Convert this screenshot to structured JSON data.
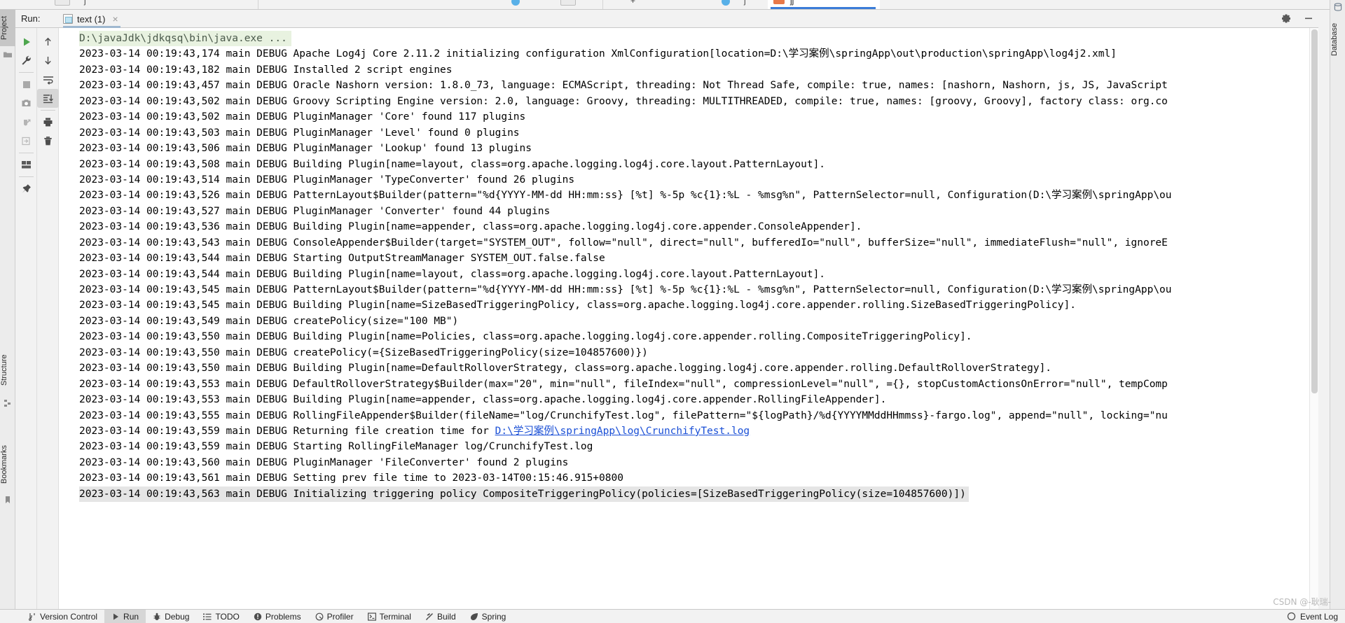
{
  "window": {
    "run_label": "Run:",
    "tab_title": "text (1)",
    "tab_close": "×",
    "settings_icon": "gear-icon",
    "minimize_icon": "minimize-icon"
  },
  "left_rail": {
    "items": [
      {
        "label": "Project",
        "icon": "project-folder-icon",
        "selected": true
      },
      {
        "label": "Structure",
        "icon": "structure-icon",
        "selected": false
      },
      {
        "label": "Bookmarks",
        "icon": "bookmarks-icon",
        "selected": false
      }
    ]
  },
  "right_rail": {
    "items": [
      {
        "label": "Database",
        "icon": "database-icon"
      }
    ]
  },
  "toolbar_primary": {
    "buttons": [
      {
        "name": "rerun-button",
        "icon": "play-green-icon",
        "label": "Rerun"
      },
      {
        "name": "edit-configuration-button",
        "icon": "wrench-icon",
        "label": "Edit Configuration"
      },
      {
        "name": "stop-button",
        "icon": "stop-square-icon",
        "label": "Stop"
      },
      {
        "name": "screenshot-button",
        "icon": "camera-icon",
        "label": "Screenshot"
      },
      {
        "name": "restart-debug-button",
        "icon": "bug-restart-icon",
        "label": "Restart Debug"
      },
      {
        "name": "resume-button",
        "icon": "arrow-into-box-icon",
        "label": "Resume Program"
      },
      {
        "name": "layout-button",
        "icon": "layout-grid-icon",
        "label": "Layout Settings"
      },
      {
        "name": "pin-button",
        "icon": "pin-icon",
        "label": "Pin Tab"
      }
    ]
  },
  "toolbar_secondary": {
    "buttons": [
      {
        "name": "up-button",
        "icon": "arrow-up-icon",
        "label": "Up The Stack Trace"
      },
      {
        "name": "down-button",
        "icon": "arrow-down-icon",
        "label": "Down The Stack Trace"
      },
      {
        "name": "soft-wrap-button",
        "icon": "soft-wrap-icon",
        "label": "Soft-Wrap"
      },
      {
        "name": "scroll-to-end-button",
        "icon": "scroll-to-end-icon",
        "label": "Scroll To End",
        "active": true
      },
      {
        "name": "print-button",
        "icon": "printer-icon",
        "label": "Print"
      },
      {
        "name": "clear-all-button",
        "icon": "trash-icon",
        "label": "Clear All"
      }
    ]
  },
  "console": {
    "command_line": "D:\\javaJdk\\jdkqsq\\bin\\java.exe ...",
    "link_line": {
      "prefix": "2023-03-14 00:19:43,559 main DEBUG Returning file creation time for ",
      "link": "D:\\学习案例\\springApp\\log\\CrunchifyTest.log"
    },
    "lines": [
      "2023-03-14 00:19:43,174 main DEBUG Apache Log4j Core 2.11.2 initializing configuration XmlConfiguration[location=D:\\学习案例\\springApp\\out\\production\\springApp\\log4j2.xml]",
      "2023-03-14 00:19:43,182 main DEBUG Installed 2 script engines",
      "2023-03-14 00:19:43,457 main DEBUG Oracle Nashorn version: 1.8.0_73, language: ECMAScript, threading: Not Thread Safe, compile: true, names: [nashorn, Nashorn, js, JS, JavaScript",
      "2023-03-14 00:19:43,502 main DEBUG Groovy Scripting Engine version: 2.0, language: Groovy, threading: MULTITHREADED, compile: true, names: [groovy, Groovy], factory class: org.co",
      "2023-03-14 00:19:43,502 main DEBUG PluginManager 'Core' found 117 plugins",
      "2023-03-14 00:19:43,503 main DEBUG PluginManager 'Level' found 0 plugins",
      "2023-03-14 00:19:43,506 main DEBUG PluginManager 'Lookup' found 13 plugins",
      "2023-03-14 00:19:43,508 main DEBUG Building Plugin[name=layout, class=org.apache.logging.log4j.core.layout.PatternLayout].",
      "2023-03-14 00:19:43,514 main DEBUG PluginManager 'TypeConverter' found 26 plugins",
      "2023-03-14 00:19:43,526 main DEBUG PatternLayout$Builder(pattern=\"%d{YYYY-MM-dd HH:mm:ss} [%t] %-5p %c{1}:%L - %msg%n\", PatternSelector=null, Configuration(D:\\学习案例\\springApp\\ou",
      "2023-03-14 00:19:43,527 main DEBUG PluginManager 'Converter' found 44 plugins",
      "2023-03-14 00:19:43,536 main DEBUG Building Plugin[name=appender, class=org.apache.logging.log4j.core.appender.ConsoleAppender].",
      "2023-03-14 00:19:43,543 main DEBUG ConsoleAppender$Builder(target=\"SYSTEM_OUT\", follow=\"null\", direct=\"null\", bufferedIo=\"null\", bufferSize=\"null\", immediateFlush=\"null\", ignoreE",
      "2023-03-14 00:19:43,544 main DEBUG Starting OutputStreamManager SYSTEM_OUT.false.false",
      "2023-03-14 00:19:43,544 main DEBUG Building Plugin[name=layout, class=org.apache.logging.log4j.core.layout.PatternLayout].",
      "2023-03-14 00:19:43,545 main DEBUG PatternLayout$Builder(pattern=\"%d{YYYY-MM-dd HH:mm:ss} [%t] %-5p %c{1}:%L - %msg%n\", PatternSelector=null, Configuration(D:\\学习案例\\springApp\\ou",
      "2023-03-14 00:19:43,545 main DEBUG Building Plugin[name=SizeBasedTriggeringPolicy, class=org.apache.logging.log4j.core.appender.rolling.SizeBasedTriggeringPolicy].",
      "2023-03-14 00:19:43,549 main DEBUG createPolicy(size=\"100 MB\")",
      "2023-03-14 00:19:43,550 main DEBUG Building Plugin[name=Policies, class=org.apache.logging.log4j.core.appender.rolling.CompositeTriggeringPolicy].",
      "2023-03-14 00:19:43,550 main DEBUG createPolicy(={SizeBasedTriggeringPolicy(size=104857600)})",
      "2023-03-14 00:19:43,550 main DEBUG Building Plugin[name=DefaultRolloverStrategy, class=org.apache.logging.log4j.core.appender.rolling.DefaultRolloverStrategy].",
      "2023-03-14 00:19:43,553 main DEBUG DefaultRolloverStrategy$Builder(max=\"20\", min=\"null\", fileIndex=\"null\", compressionLevel=\"null\", ={}, stopCustomActionsOnError=\"null\", tempComp",
      "2023-03-14 00:19:43,553 main DEBUG Building Plugin[name=appender, class=org.apache.logging.log4j.core.appender.RollingFileAppender].",
      "2023-03-14 00:19:43,555 main DEBUG RollingFileAppender$Builder(fileName=\"log/CrunchifyTest.log\", filePattern=\"${logPath}/%d{YYYYMMddHHmmss}-fargo.log\", append=\"null\", locking=\"nu",
      "__LINK__",
      "2023-03-14 00:19:43,559 main DEBUG Starting RollingFileManager log/CrunchifyTest.log",
      "2023-03-14 00:19:43,560 main DEBUG PluginManager 'FileConverter' found 2 plugins",
      "2023-03-14 00:19:43,561 main DEBUG Setting prev file time to 2023-03-14T00:15:46.915+0800",
      "__SEL__2023-03-14 00:19:43,563 main DEBUG Initializing triggering policy CompositeTriggeringPolicy(policies=[SizeBasedTriggeringPolicy(size=104857600)])"
    ]
  },
  "statusbar": {
    "items": [
      {
        "label": "Version Control",
        "icon": "branch-icon",
        "selected": false
      },
      {
        "label": "Run",
        "icon": "play-icon",
        "selected": true
      },
      {
        "label": "Debug",
        "icon": "bug-icon",
        "selected": false
      },
      {
        "label": "TODO",
        "icon": "todo-list-icon",
        "selected": false
      },
      {
        "label": "Problems",
        "icon": "problems-icon",
        "selected": false
      },
      {
        "label": "Profiler",
        "icon": "profiler-icon",
        "selected": false
      },
      {
        "label": "Terminal",
        "icon": "terminal-icon",
        "selected": false
      },
      {
        "label": "Build",
        "icon": "build-hammer-icon",
        "selected": false
      },
      {
        "label": "Spring",
        "icon": "spring-leaf-icon",
        "selected": false
      }
    ],
    "right": {
      "label": "Event Log",
      "icon": "event-log-icon"
    }
  },
  "watermark": {
    "text": "CSDN @-耿瑞-"
  },
  "colors": {
    "accent_blue": "#3b7dd8",
    "link_blue": "#1a4fd6",
    "run_green": "#4ea64e",
    "command_bg": "#e8f2e0",
    "selection_bg": "#e5e5e5",
    "panel_bg": "#f2f2f2",
    "console_bg": "#ffffff"
  }
}
